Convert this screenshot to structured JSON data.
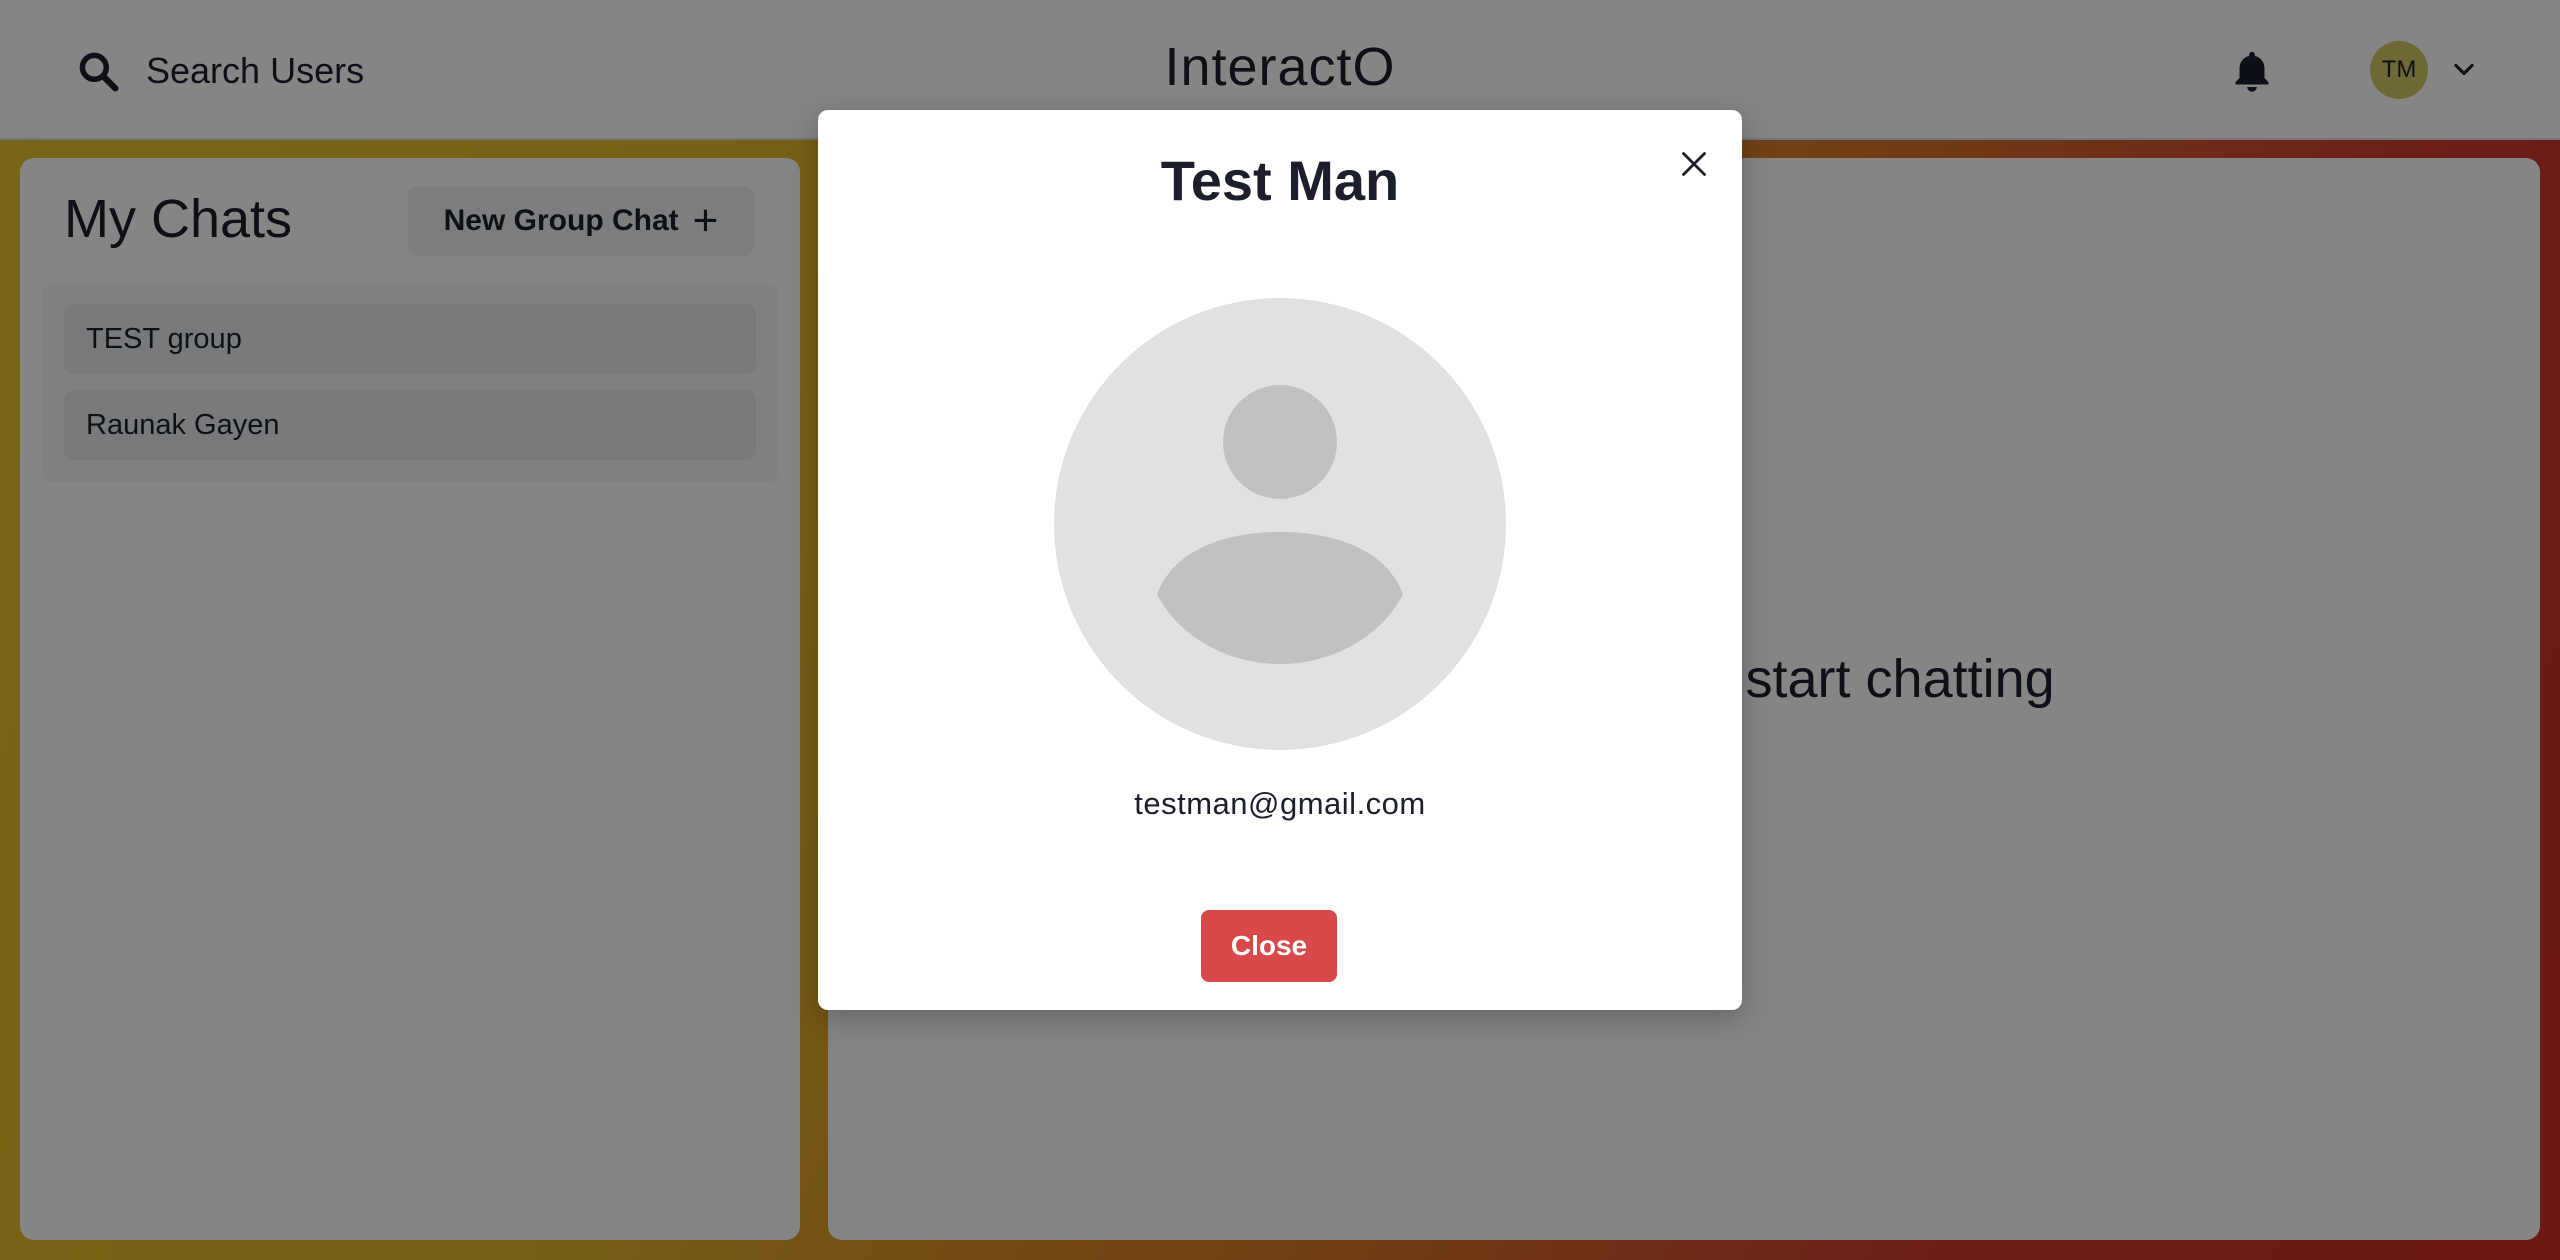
{
  "header": {
    "search_label": "Search Users",
    "brand": "InteractO",
    "avatar_initials": "TM"
  },
  "sidebar": {
    "title": "My Chats",
    "new_group_label": "New Group Chat",
    "chats": [
      {
        "name": "TEST group"
      },
      {
        "name": "Raunak Gayen"
      }
    ]
  },
  "main": {
    "empty_message": "Click on a user to start chatting"
  },
  "modal": {
    "title": "Test Man",
    "email": "testman@gmail.com",
    "close_label": "Close"
  },
  "colors": {
    "close_button": "#d94848",
    "avatar": "#d4c76a",
    "background_gradient": [
      "#e8c62e",
      "#d8752a",
      "#cf2f2a"
    ]
  },
  "icons": {
    "search": "search-icon",
    "notifications": "bell-icon",
    "menu": "chevron-down-icon",
    "add": "plus-icon",
    "dismiss": "close-icon"
  }
}
